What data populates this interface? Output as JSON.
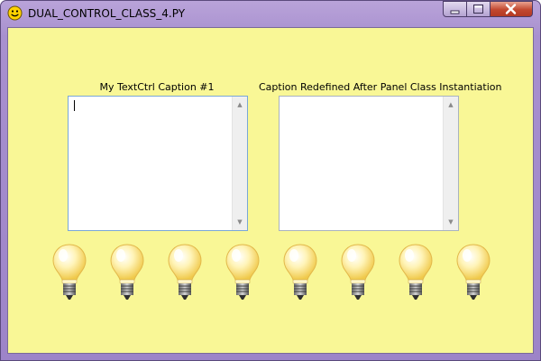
{
  "window": {
    "title": "DUAL_CONTROL_CLASS_4.PY",
    "app_icon": "smiley-icon",
    "controls": [
      "minimize-icon",
      "maximize-icon",
      "close-icon"
    ]
  },
  "panel": {
    "background_color": "#f9f796",
    "textctrl1": {
      "caption": "My TextCtrl Caption #1",
      "value": ""
    },
    "textctrl2": {
      "caption": "Caption Redefined After Panel Class Instantiation",
      "value": ""
    },
    "bulb_icon": "lightbulb-icon",
    "bulb_count": 8
  }
}
